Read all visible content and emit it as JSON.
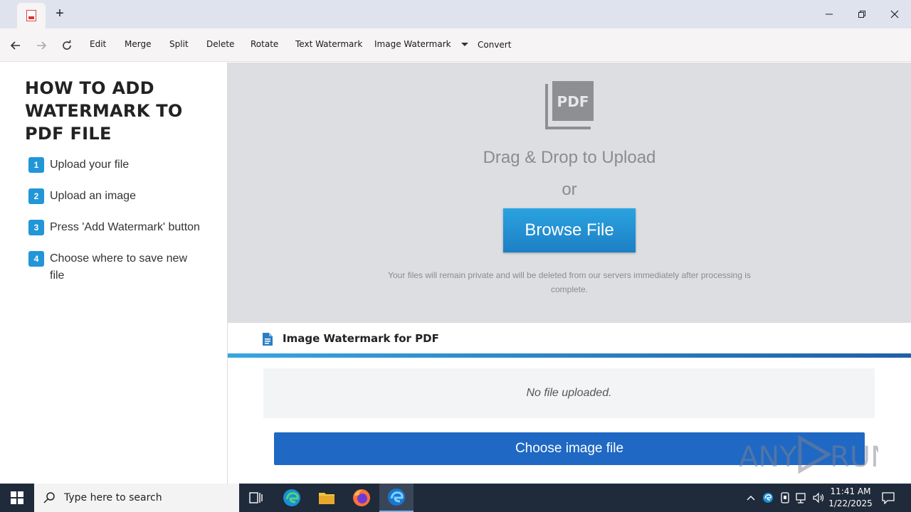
{
  "toolbar": {
    "menu": [
      "Edit",
      "Merge",
      "Split",
      "Delete",
      "Rotate",
      "Text Watermark",
      "Image Watermark",
      "Convert"
    ]
  },
  "sidebar": {
    "heading_lines": [
      "HOW TO ADD",
      "WATERMARK TO",
      "PDF FILE"
    ],
    "steps": [
      {
        "num": "1",
        "text": "Upload your file"
      },
      {
        "num": "2",
        "text": "Upload an image"
      },
      {
        "num": "3",
        "text": "Press 'Add Watermark' button"
      },
      {
        "num": "4",
        "text": "Choose where to save new file"
      }
    ]
  },
  "upload": {
    "icon_label": "PDF",
    "drag_text": "Drag & Drop to Upload",
    "or_text": "or",
    "browse_label": "Browse File",
    "privacy_text": "Your files will remain private and will be deleted from our servers immediately after processing is complete."
  },
  "watermark": {
    "title": "Image Watermark for PDF",
    "status": "No file uploaded.",
    "choose_label": "Choose image file"
  },
  "brand": {
    "logo_text": "ANY RUN"
  },
  "taskbar": {
    "search_placeholder": "Type here to search",
    "time": "11:41 AM",
    "date": "1/22/2025"
  },
  "colors": {
    "accent_blue": "#2196d8",
    "button_blue": "#1f68c4",
    "upload_bg": "#dcdee2",
    "taskbar_bg": "#1f2a3a"
  }
}
